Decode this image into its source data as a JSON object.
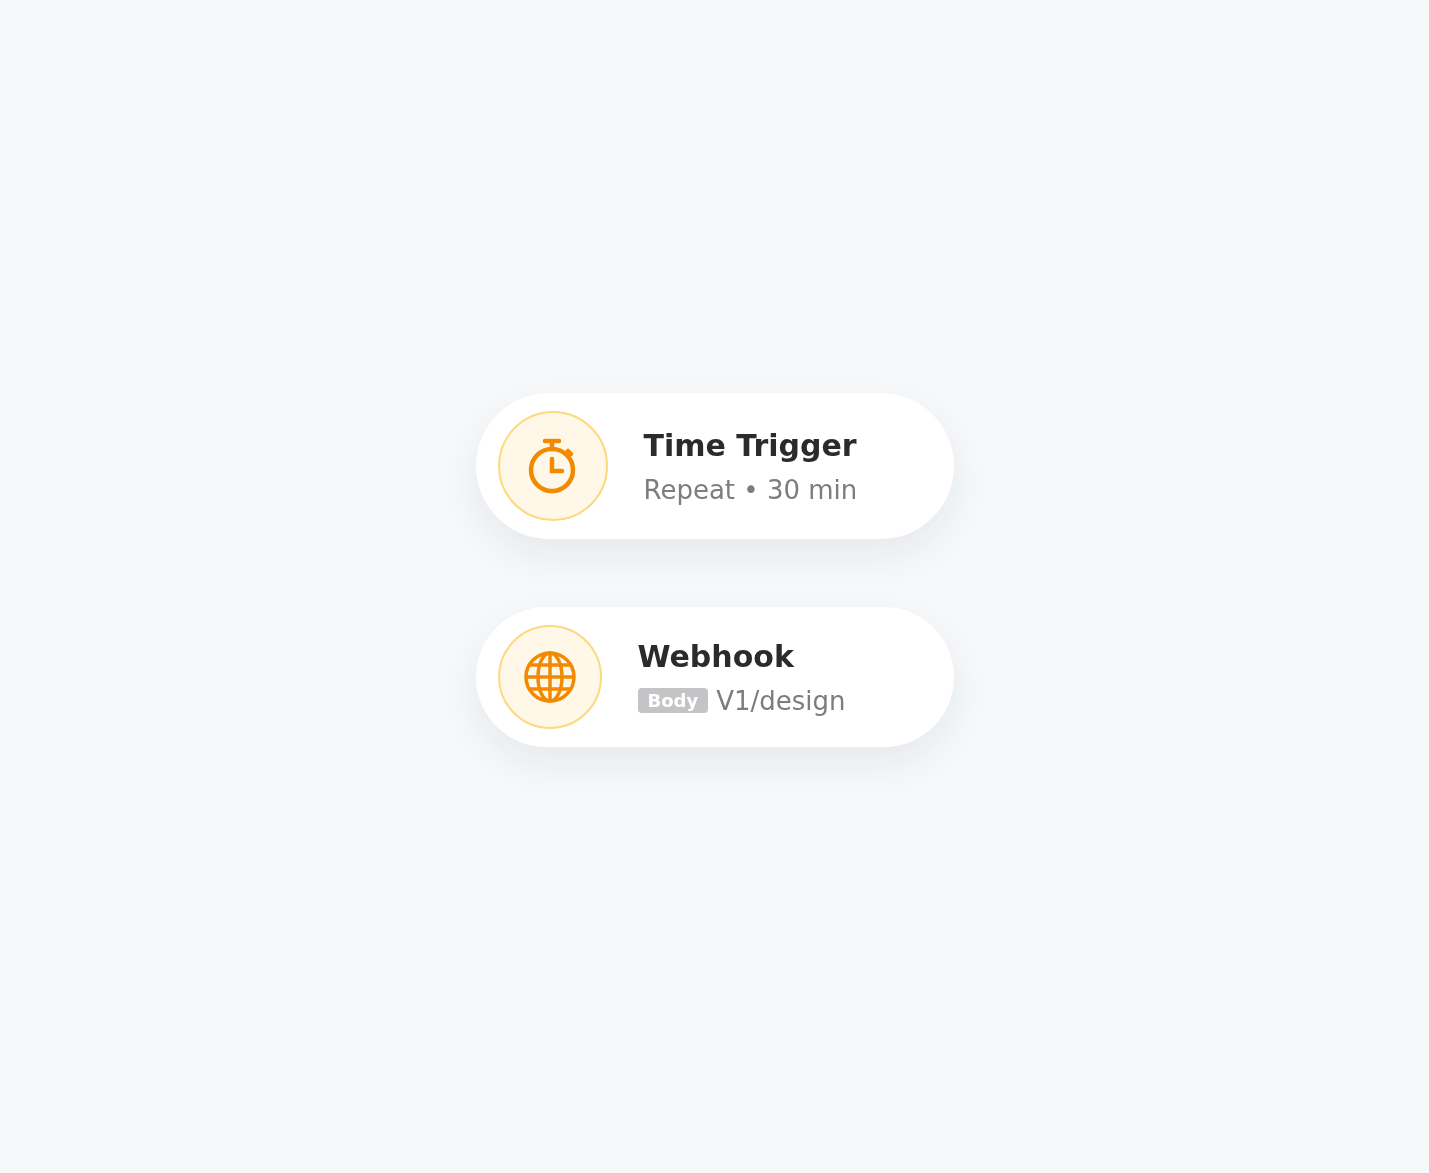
{
  "triggers": [
    {
      "kind": "timer",
      "title": "Time Trigger",
      "subtitle": "Repeat • 30 min"
    },
    {
      "kind": "webhook",
      "title": "Webhook",
      "tag": "Body",
      "subtitle": "V1/design"
    }
  ]
}
